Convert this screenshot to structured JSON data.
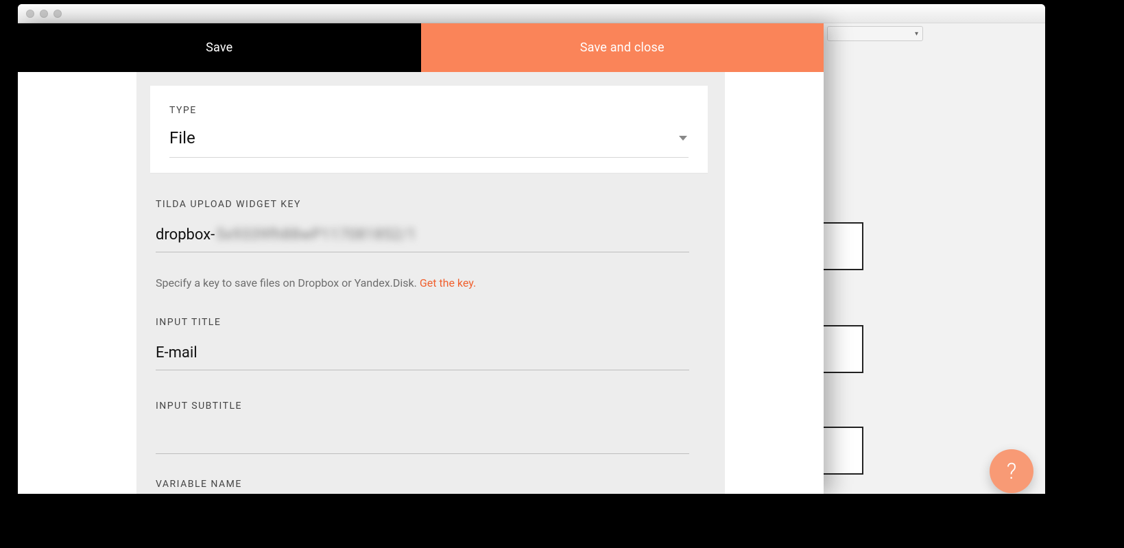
{
  "header": {
    "save_label": "Save",
    "save_close_label": "Save and close"
  },
  "fields": {
    "type": {
      "label": "TYPE",
      "value": "File"
    },
    "widget_key": {
      "label": "TILDA UPLOAD WIDGET KEY",
      "value_prefix": "dropbox-",
      "value_blurred": "5x9339fh88wP117081852/1"
    },
    "widget_key_helper": {
      "text": "Specify a key to save files on Dropbox or Yandex.Disk. ",
      "link_text": "Get the key."
    },
    "input_title": {
      "label": "INPUT TITLE",
      "value": "E-mail"
    },
    "input_subtitle": {
      "label": "INPUT SUBTITLE",
      "value": ""
    },
    "variable_name": {
      "label": "VARIABLE NAME"
    }
  },
  "help_fab": {
    "glyph": "?"
  }
}
